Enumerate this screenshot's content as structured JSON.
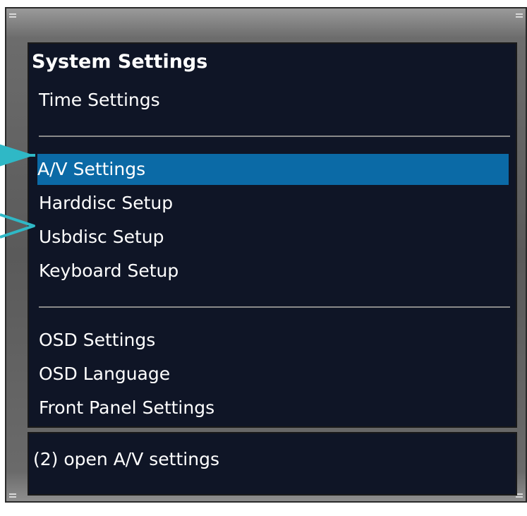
{
  "menu": {
    "title": "System Settings",
    "items": [
      {
        "label": "Time Settings"
      },
      {
        "label": "A/V Settings",
        "selected": true
      },
      {
        "label": "Harddisc Setup"
      },
      {
        "label": "Usbdisc Setup"
      },
      {
        "label": "Keyboard Setup"
      },
      {
        "label": "OSD Settings"
      },
      {
        "label": "OSD Language"
      },
      {
        "label": "Front Panel Settings"
      }
    ]
  },
  "status": {
    "text": "(2) open A/V settings"
  },
  "colors": {
    "panel_background": "#0f1526",
    "selection": "#0b6aa6",
    "pointer_arrow": "#2fb8c6"
  },
  "icons": {
    "pointer": "arrow-pointer-icon"
  }
}
